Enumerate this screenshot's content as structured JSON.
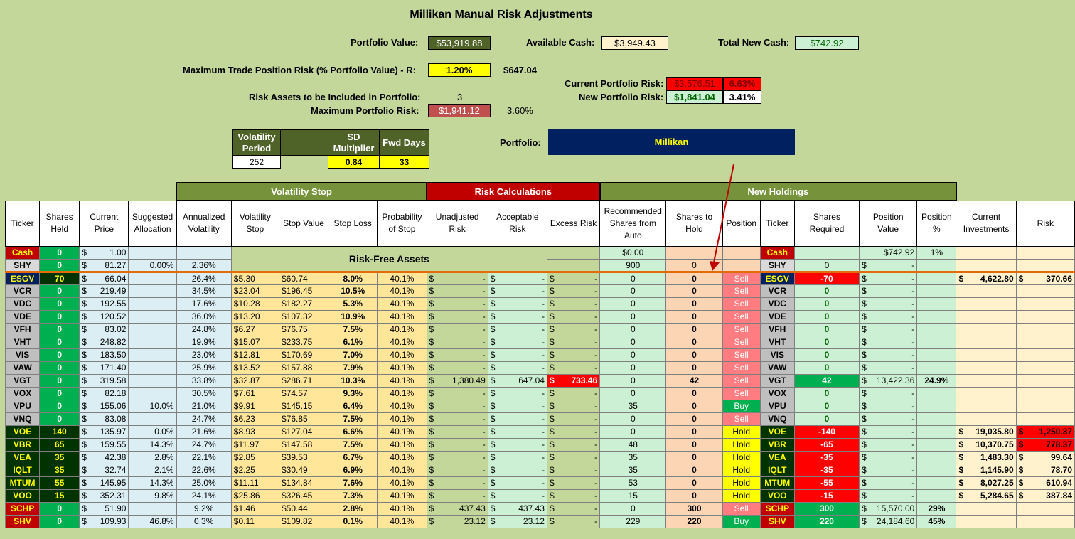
{
  "title": "Millikan Manual Risk Adjustments",
  "summary": {
    "portfolio_value_label": "Portfolio Value:",
    "portfolio_value": "$53,919.88",
    "available_cash_label": "Available Cash:",
    "available_cash": "$3,949.43",
    "total_new_cash_label": "Total New Cash:",
    "total_new_cash": "$742.92",
    "max_trade_risk_label": "Maximum Trade Position Risk (% Portfolio Value) - R:",
    "max_trade_risk_pct": "1.20%",
    "max_trade_risk_amt": "$647.04",
    "current_risk_label": "Current Portfolio Risk:",
    "current_risk_amt": "$3,576.51",
    "current_risk_pct": "6.63%",
    "new_risk_label": "New Portfolio Risk:",
    "new_risk_amt": "$1,841.04",
    "new_risk_pct": "3.41%",
    "risk_assets_label": "Risk Assets to be Included in Portfolio:",
    "risk_assets": "3",
    "max_portfolio_risk_label": "Maximum Portfolio Risk:",
    "max_portfolio_risk_amt": "$1,941.12",
    "max_portfolio_risk_pct": "3.60%",
    "portfolio_label": "Portfolio:",
    "portfolio_name": "Millikan"
  },
  "params": {
    "vol_period_label": "Volatility Period",
    "vol_period": "252",
    "sd_mult_label": "SD Multiplier",
    "sd_mult": "0.84",
    "fwd_days_label": "Fwd Days",
    "fwd_days": "33"
  },
  "sections": {
    "vol_stop": "Volatility Stop",
    "risk_calc": "Risk Calculations",
    "new_holdings": "New Holdings",
    "risk_free": "Risk-Free Assets"
  },
  "columns": [
    "Ticker",
    "Shares Held",
    "Current Price",
    "Suggested Allocation",
    "Annualized Volatility",
    "Volatility Stop",
    "Stop Value",
    "Stop Loss",
    "Probability of Stop",
    "Unadjusted Risk",
    "Acceptable Risk",
    "Excess Risk",
    "Recommended Shares from Auto",
    "Shares to Hold",
    "Position",
    "Ticker",
    "Shares Required",
    "Position Value",
    "Position %",
    "Current Investments",
    "Risk"
  ],
  "cash_rows": [
    {
      "ticker": "Cash",
      "shares": "0",
      "price": "1.00",
      "alloc": "",
      "vol": "",
      "rec": "$0.00",
      "hold": "",
      "pos": "",
      "req": "",
      "pval": "$742.92",
      "ppct": "1%"
    },
    {
      "ticker": "SHY",
      "shares": "0",
      "price": "81.27",
      "alloc": "0.00%",
      "vol": "2.36%",
      "rec": "900",
      "hold": "0",
      "pos": "",
      "req": "0",
      "pval": "-",
      "ppct": ""
    }
  ],
  "rows": [
    {
      "t": "ESGV",
      "c": "blue",
      "sh": "70",
      "pr": "66.04",
      "al": "",
      "av": "26.4%",
      "vs": "$5.30",
      "sv": "$60.74",
      "sl": "8.0%",
      "ps": "40.1%",
      "ur": "-",
      "ar": "-",
      "er": "-",
      "rs": "0",
      "hd": "0",
      "po": "Sell",
      "rq": "-70",
      "pv": "-",
      "pp": "",
      "ci": "4,622.80",
      "rk": "370.66"
    },
    {
      "t": "VCR",
      "c": "grey",
      "sh": "0",
      "pr": "219.49",
      "al": "",
      "av": "34.5%",
      "vs": "$23.04",
      "sv": "$196.45",
      "sl": "10.5%",
      "ps": "40.1%",
      "ur": "-",
      "ar": "-",
      "er": "-",
      "rs": "0",
      "hd": "0",
      "po": "Sell",
      "rq": "0",
      "pv": "-",
      "pp": "",
      "ci": "",
      "rk": ""
    },
    {
      "t": "VDC",
      "c": "grey",
      "sh": "0",
      "pr": "192.55",
      "al": "",
      "av": "17.6%",
      "vs": "$10.28",
      "sv": "$182.27",
      "sl": "5.3%",
      "ps": "40.1%",
      "ur": "-",
      "ar": "-",
      "er": "-",
      "rs": "0",
      "hd": "0",
      "po": "Sell",
      "rq": "0",
      "pv": "-",
      "pp": "",
      "ci": "",
      "rk": ""
    },
    {
      "t": "VDE",
      "c": "grey",
      "sh": "0",
      "pr": "120.52",
      "al": "",
      "av": "36.0%",
      "vs": "$13.20",
      "sv": "$107.32",
      "sl": "10.9%",
      "ps": "40.1%",
      "ur": "-",
      "ar": "-",
      "er": "-",
      "rs": "0",
      "hd": "0",
      "po": "Sell",
      "rq": "0",
      "pv": "-",
      "pp": "",
      "ci": "",
      "rk": ""
    },
    {
      "t": "VFH",
      "c": "grey",
      "sh": "0",
      "pr": "83.02",
      "al": "",
      "av": "24.8%",
      "vs": "$6.27",
      "sv": "$76.75",
      "sl": "7.5%",
      "ps": "40.1%",
      "ur": "-",
      "ar": "-",
      "er": "-",
      "rs": "0",
      "hd": "0",
      "po": "Sell",
      "rq": "0",
      "pv": "-",
      "pp": "",
      "ci": "",
      "rk": ""
    },
    {
      "t": "VHT",
      "c": "grey",
      "sh": "0",
      "pr": "248.82",
      "al": "",
      "av": "19.9%",
      "vs": "$15.07",
      "sv": "$233.75",
      "sl": "6.1%",
      "ps": "40.1%",
      "ur": "-",
      "ar": "-",
      "er": "-",
      "rs": "0",
      "hd": "0",
      "po": "Sell",
      "rq": "0",
      "pv": "-",
      "pp": "",
      "ci": "",
      "rk": ""
    },
    {
      "t": "VIS",
      "c": "grey",
      "sh": "0",
      "pr": "183.50",
      "al": "",
      "av": "23.0%",
      "vs": "$12.81",
      "sv": "$170.69",
      "sl": "7.0%",
      "ps": "40.1%",
      "ur": "-",
      "ar": "-",
      "er": "-",
      "rs": "0",
      "hd": "0",
      "po": "Sell",
      "rq": "0",
      "pv": "-",
      "pp": "",
      "ci": "",
      "rk": ""
    },
    {
      "t": "VAW",
      "c": "grey",
      "sh": "0",
      "pr": "171.40",
      "al": "",
      "av": "25.9%",
      "vs": "$13.52",
      "sv": "$157.88",
      "sl": "7.9%",
      "ps": "40.1%",
      "ur": "-",
      "ar": "-",
      "er": "-",
      "rs": "0",
      "hd": "0",
      "po": "Sell",
      "rq": "0",
      "pv": "-",
      "pp": "",
      "ci": "",
      "rk": ""
    },
    {
      "t": "VGT",
      "c": "grey",
      "sh": "0",
      "pr": "319.58",
      "al": "",
      "av": "33.8%",
      "vs": "$32.87",
      "sv": "$286.71",
      "sl": "10.3%",
      "ps": "40.1%",
      "ur": "1,380.49",
      "ar": "647.04",
      "er": "733.46",
      "rs": "0",
      "hd": "42",
      "po": "Sell",
      "rq": "42",
      "pv": "13,422.36",
      "pp": "24.9%",
      "ci": "",
      "rk": ""
    },
    {
      "t": "VOX",
      "c": "grey",
      "sh": "0",
      "pr": "82.18",
      "al": "",
      "av": "30.5%",
      "vs": "$7.61",
      "sv": "$74.57",
      "sl": "9.3%",
      "ps": "40.1%",
      "ur": "-",
      "ar": "-",
      "er": "-",
      "rs": "0",
      "hd": "0",
      "po": "Sell",
      "rq": "0",
      "pv": "-",
      "pp": "",
      "ci": "",
      "rk": ""
    },
    {
      "t": "VPU",
      "c": "grey",
      "sh": "0",
      "pr": "155.06",
      "al": "10.0%",
      "av": "21.0%",
      "vs": "$9.91",
      "sv": "$145.15",
      "sl": "6.4%",
      "ps": "40.1%",
      "ur": "-",
      "ar": "-",
      "er": "-",
      "rs": "35",
      "hd": "0",
      "po": "Buy",
      "rq": "0",
      "pv": "-",
      "pp": "",
      "ci": "",
      "rk": ""
    },
    {
      "t": "VNQ",
      "c": "grey",
      "sh": "0",
      "pr": "83.08",
      "al": "",
      "av": "24.7%",
      "vs": "$6.23",
      "sv": "$76.85",
      "sl": "7.5%",
      "ps": "40.1%",
      "ur": "-",
      "ar": "-",
      "er": "-",
      "rs": "0",
      "hd": "0",
      "po": "Sell",
      "rq": "0",
      "pv": "-",
      "pp": "",
      "ci": "",
      "rk": ""
    },
    {
      "t": "VOE",
      "c": "dgreen",
      "sh": "140",
      "pr": "135.97",
      "al": "0.0%",
      "av": "21.6%",
      "vs": "$8.93",
      "sv": "$127.04",
      "sl": "6.6%",
      "ps": "40.1%",
      "ur": "-",
      "ar": "-",
      "er": "-",
      "rs": "0",
      "hd": "0",
      "po": "Hold",
      "rq": "-140",
      "pv": "-",
      "pp": "",
      "ci": "19,035.80",
      "rk": "1,250.37"
    },
    {
      "t": "VBR",
      "c": "dgreen",
      "sh": "65",
      "pr": "159.55",
      "al": "14.3%",
      "av": "24.7%",
      "vs": "$11.97",
      "sv": "$147.58",
      "sl": "7.5%",
      "ps": "40.1%",
      "ur": "-",
      "ar": "-",
      "er": "-",
      "rs": "48",
      "hd": "0",
      "po": "Hold",
      "rq": "-65",
      "pv": "-",
      "pp": "",
      "ci": "10,370.75",
      "rk": "778.37"
    },
    {
      "t": "VEA",
      "c": "dgreen",
      "sh": "35",
      "pr": "42.38",
      "al": "2.8%",
      "av": "22.1%",
      "vs": "$2.85",
      "sv": "$39.53",
      "sl": "6.7%",
      "ps": "40.1%",
      "ur": "-",
      "ar": "-",
      "er": "-",
      "rs": "35",
      "hd": "0",
      "po": "Hold",
      "rq": "-35",
      "pv": "-",
      "pp": "",
      "ci": "1,483.30",
      "rk": "99.64"
    },
    {
      "t": "IQLT",
      "c": "dgreen",
      "sh": "35",
      "pr": "32.74",
      "al": "2.1%",
      "av": "22.6%",
      "vs": "$2.25",
      "sv": "$30.49",
      "sl": "6.9%",
      "ps": "40.1%",
      "ur": "-",
      "ar": "-",
      "er": "-",
      "rs": "35",
      "hd": "0",
      "po": "Hold",
      "rq": "-35",
      "pv": "-",
      "pp": "",
      "ci": "1,145.90",
      "rk": "78.70"
    },
    {
      "t": "MTUM",
      "c": "dgreen",
      "sh": "55",
      "pr": "145.95",
      "al": "14.3%",
      "av": "25.0%",
      "vs": "$11.11",
      "sv": "$134.84",
      "sl": "7.6%",
      "ps": "40.1%",
      "ur": "-",
      "ar": "-",
      "er": "-",
      "rs": "53",
      "hd": "0",
      "po": "Hold",
      "rq": "-55",
      "pv": "-",
      "pp": "",
      "ci": "8,027.25",
      "rk": "610.94"
    },
    {
      "t": "VOO",
      "c": "dgreen",
      "sh": "15",
      "pr": "352.31",
      "al": "9.8%",
      "av": "24.1%",
      "vs": "$25.86",
      "sv": "$326.45",
      "sl": "7.3%",
      "ps": "40.1%",
      "ur": "-",
      "ar": "-",
      "er": "-",
      "rs": "15",
      "hd": "0",
      "po": "Hold",
      "rq": "-15",
      "pv": "-",
      "pp": "",
      "ci": "5,284.65",
      "rk": "387.84"
    },
    {
      "t": "SCHP",
      "c": "red",
      "sh": "0",
      "pr": "51.90",
      "al": "",
      "av": "9.2%",
      "vs": "$1.46",
      "sv": "$50.44",
      "sl": "2.8%",
      "ps": "40.1%",
      "ur": "437.43",
      "ar": "437.43",
      "er": "-",
      "rs": "0",
      "hd": "300",
      "po": "Sell",
      "rq": "300",
      "pv": "15,570.00",
      "pp": "29%",
      "ci": "",
      "rk": ""
    },
    {
      "t": "SHV",
      "c": "red",
      "sh": "0",
      "pr": "109.93",
      "al": "46.8%",
      "av": "0.3%",
      "vs": "$0.11",
      "sv": "$109.82",
      "sl": "0.1%",
      "ps": "40.1%",
      "ur": "23.12",
      "ar": "23.12",
      "er": "-",
      "rs": "229",
      "hd": "220",
      "po": "Buy",
      "rq": "220",
      "pv": "24,184.60",
      "pp": "45%",
      "ci": "",
      "rk": ""
    }
  ],
  "colors": {
    "background": "#c4d79b",
    "header_olive": "#4f6228",
    "risk_red": "#c00000",
    "portfolio_navy": "#002060"
  }
}
